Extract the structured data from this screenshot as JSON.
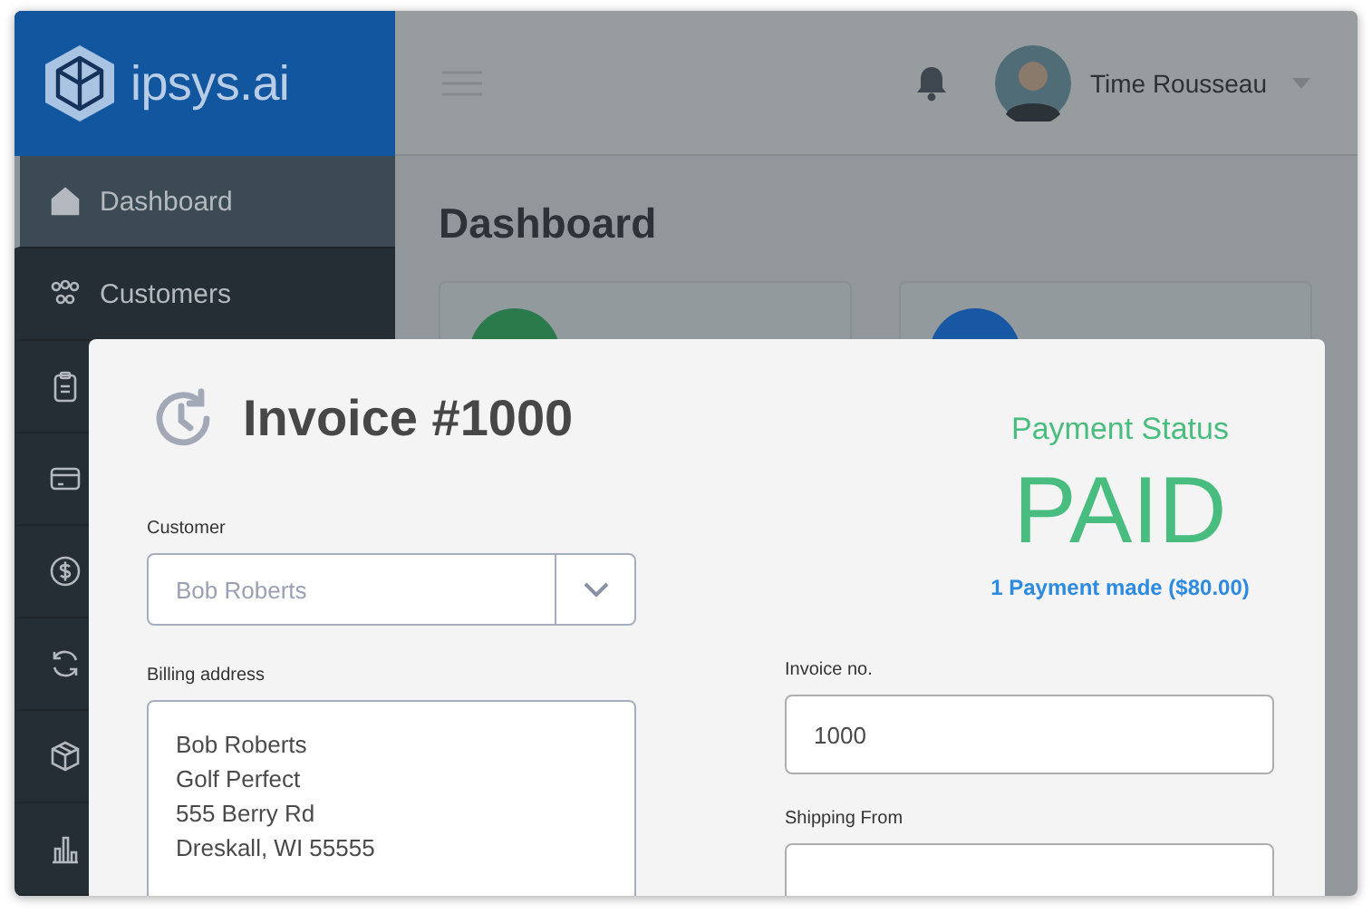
{
  "sidebar": {
    "logo": "ipsys.ai",
    "items": [
      {
        "label": "Dashboard",
        "selected": true
      },
      {
        "label": "Customers",
        "selected": false
      },
      {
        "selected": false
      },
      {
        "selected": false
      },
      {
        "selected": false
      },
      {
        "selected": false
      },
      {
        "selected": false
      },
      {
        "selected": false
      }
    ]
  },
  "header": {
    "user_name": "Time Rousseau"
  },
  "page_title": "Dashboard",
  "modal": {
    "title": "Invoice #1000",
    "customer": {
      "label": "Customer",
      "value": "Bob Roberts"
    },
    "billing_address": {
      "label": "Billing address",
      "lines": [
        "Bob Roberts",
        "Golf Perfect",
        "555 Berry Rd",
        "Dreskall, WI 55555"
      ]
    },
    "payment_status": {
      "label": "Payment Status",
      "status": "PAID",
      "payments_link": "1 Payment made ($80.00)"
    },
    "invoice_no": {
      "label": "Invoice  no.",
      "value": "1000"
    },
    "shipping_from": {
      "label": "Shipping From"
    }
  }
}
